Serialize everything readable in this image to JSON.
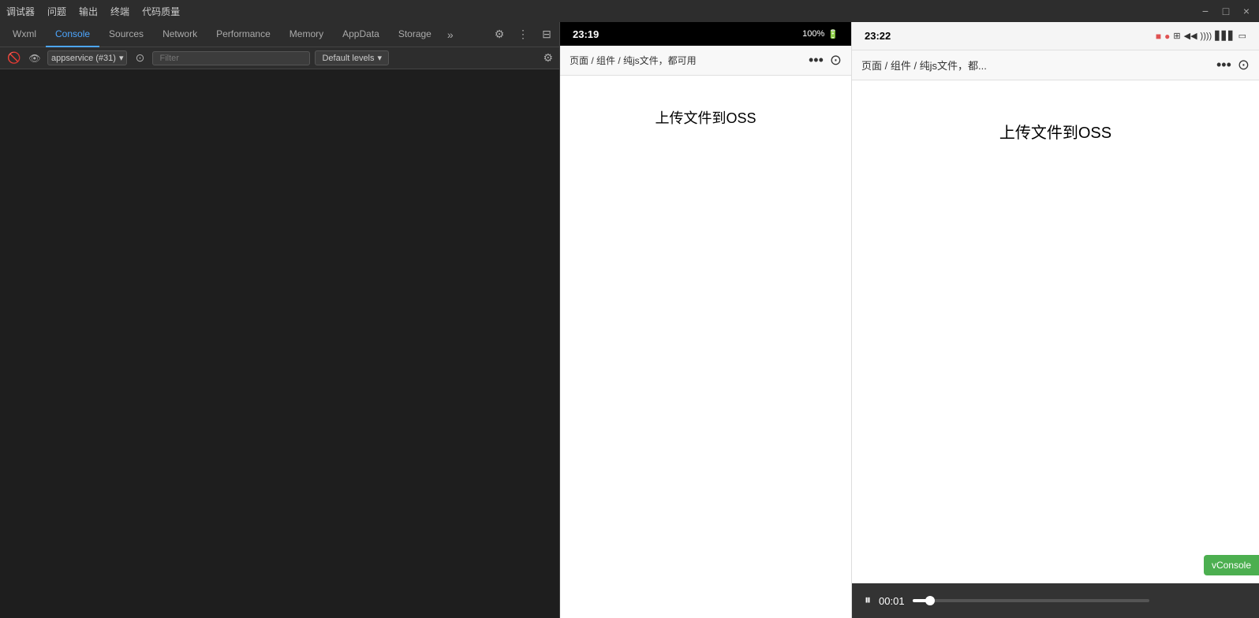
{
  "titleBar": {
    "menuItems": [
      "调试器",
      "问题",
      "输出",
      "终端",
      "代码质量"
    ],
    "closeBtn": "×",
    "minimizeBtn": "−",
    "maximizeBtn": "□"
  },
  "devtools": {
    "tabs": [
      {
        "id": "wxml",
        "label": "Wxml",
        "active": false
      },
      {
        "id": "console",
        "label": "Console",
        "active": true
      },
      {
        "id": "sources",
        "label": "Sources",
        "active": false
      },
      {
        "id": "network",
        "label": "Network",
        "active": false
      },
      {
        "id": "performance",
        "label": "Performance",
        "active": false
      },
      {
        "id": "memory",
        "label": "Memory",
        "active": false
      },
      {
        "id": "appdata",
        "label": "AppData",
        "active": false
      },
      {
        "id": "storage",
        "label": "Storage",
        "active": false
      }
    ],
    "moreBtn": "»",
    "toolbar": {
      "serviceSelector": "appservice (#31)",
      "filterPlaceholder": "Filter",
      "defaultLevels": "Default levels"
    }
  },
  "simulatorLeft": {
    "time": "23:19",
    "batteryPercent": "100%",
    "navBreadcrumb": "页面 / 组件 / 纯js文件，都可用",
    "pageTitle": "上传文件到OSS",
    "navDots": "•••"
  },
  "simulatorRight": {
    "time": "23:22",
    "navBreadcrumb": "页面 / 组件 / 纯js文件，都...",
    "pageTitle": "上传文件到OSS",
    "navDots": "•••"
  },
  "mediaBar": {
    "time": "00:01",
    "vconsoleLabel": "vConsole"
  },
  "icons": {
    "prohibit": "🚫",
    "eye": "👁",
    "settings": "⚙",
    "kebab": "⋮",
    "dock": "⊟",
    "circle": "●",
    "target": "⊙",
    "chevronDown": "▾",
    "pause": "⏸",
    "signal": "▋▋▋",
    "wifi": "wifi",
    "battery": "🔋"
  },
  "colors": {
    "activeTab": "#4da6ff",
    "tabsBg": "#2d2d2d",
    "consoleBg": "#1e1e1e",
    "vconsoleGreen": "#4CAF50",
    "recordRed": "#e05252",
    "statusOrange": "#f59342"
  }
}
